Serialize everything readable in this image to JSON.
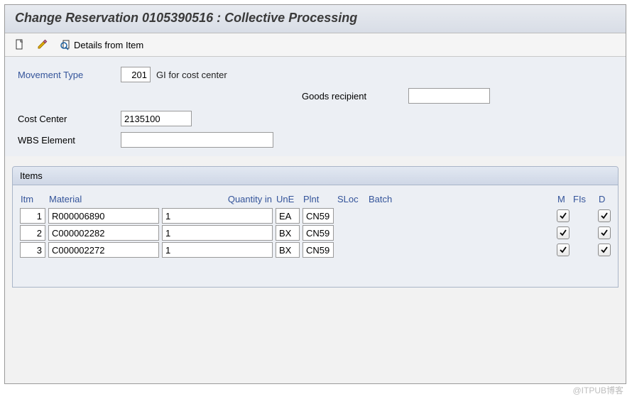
{
  "title": "Change Reservation 0105390516 : Collective Processing",
  "toolbar": {
    "details_label": "Details from Item"
  },
  "form": {
    "movement_type_label": "Movement Type",
    "movement_type_value": "201",
    "movement_type_desc": "GI for cost center",
    "goods_recipient_label": "Goods recipient",
    "goods_recipient_value": "",
    "cost_center_label": "Cost Center",
    "cost_center_value": "2135100",
    "wbs_element_label": "WBS Element",
    "wbs_element_value": ""
  },
  "items_panel": {
    "title": "Items",
    "headers": {
      "itm": "Itm",
      "material": "Material",
      "quantity_in": "Quantity in",
      "une": "UnE",
      "plnt": "Plnt",
      "sloc": "SLoc",
      "batch": "Batch",
      "m": "M",
      "fis": "FIs",
      "d": "D"
    },
    "rows": [
      {
        "itm": "1",
        "material": "R000006890",
        "qty": "1",
        "une": "EA",
        "plnt": "CN59",
        "sloc": "",
        "batch": "",
        "m": true,
        "d": true
      },
      {
        "itm": "2",
        "material": "C000002282",
        "qty": "1",
        "une": "BX",
        "plnt": "CN59",
        "sloc": "",
        "batch": "",
        "m": true,
        "d": true
      },
      {
        "itm": "3",
        "material": "C000002272",
        "qty": "1",
        "une": "BX",
        "plnt": "CN59",
        "sloc": "",
        "batch": "",
        "m": true,
        "d": true
      }
    ]
  },
  "watermark": "@ITPUB博客"
}
